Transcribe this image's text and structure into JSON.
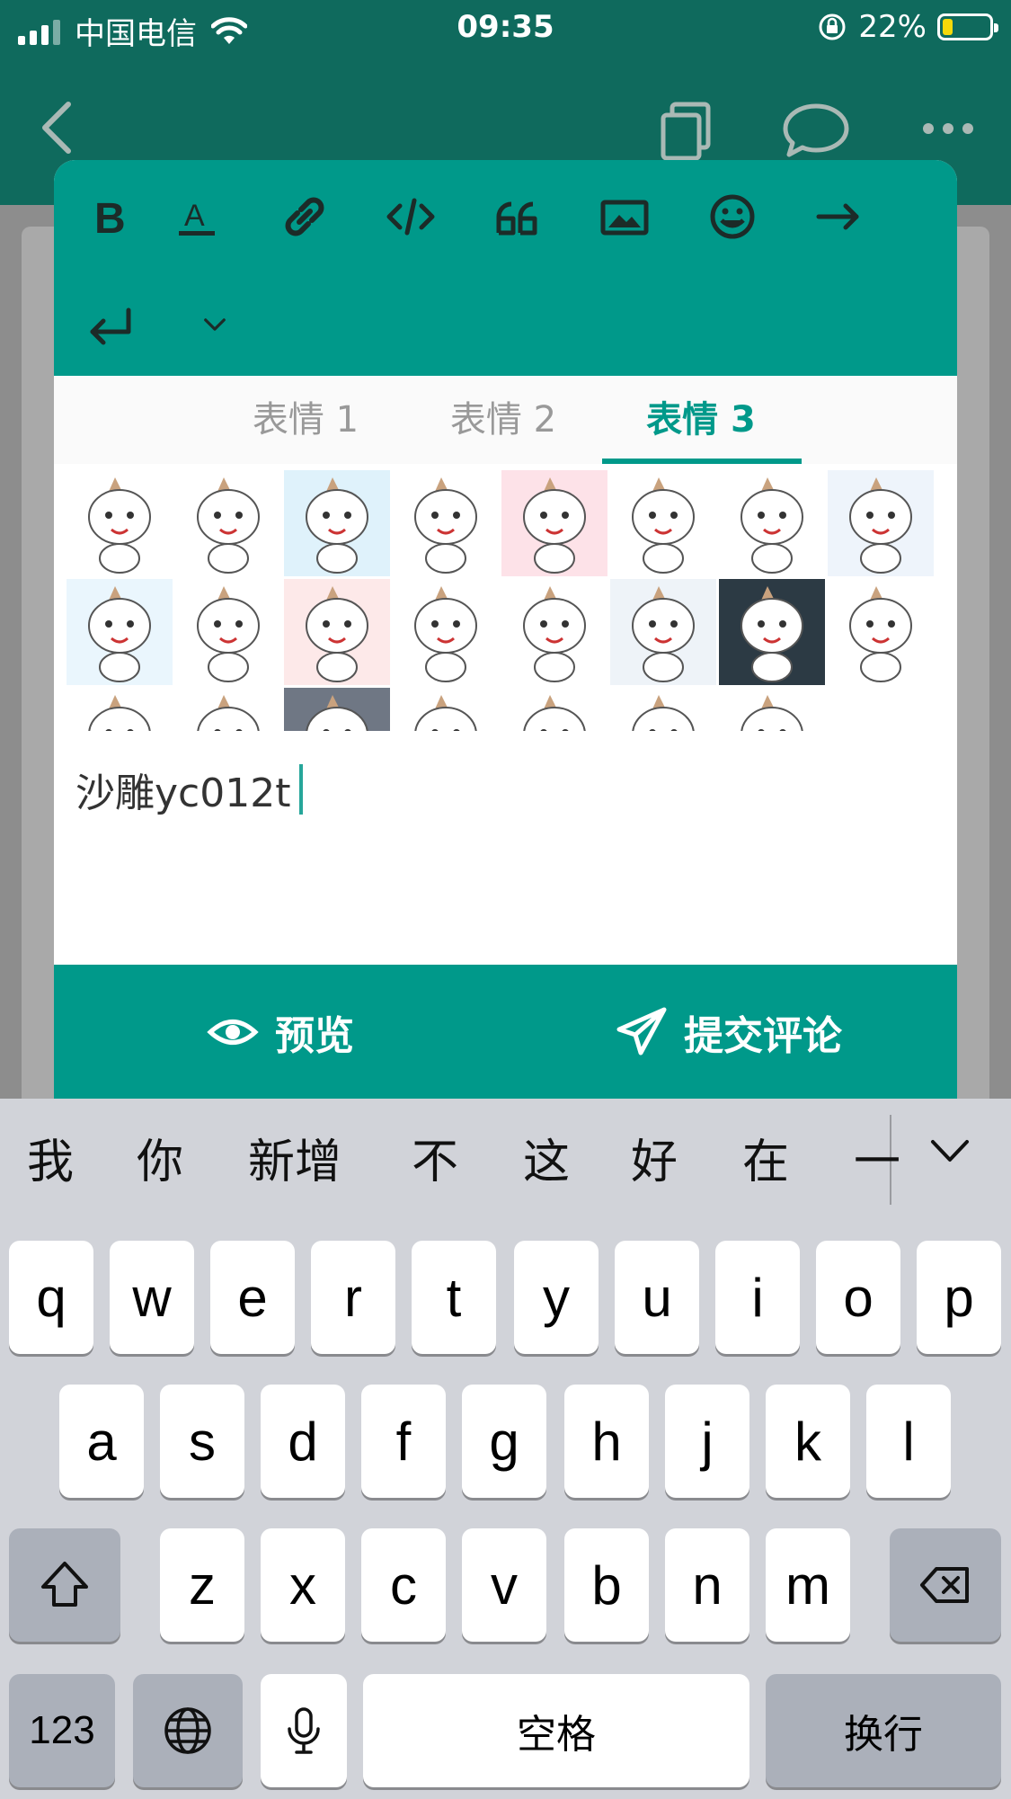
{
  "status_bar": {
    "carrier": "中国电信",
    "time": "09:35",
    "battery_percent": "22%",
    "battery_level": 0.22,
    "icons": [
      "signal-icon",
      "wifi-icon",
      "rotation-lock-icon",
      "battery-icon"
    ]
  },
  "app_bar": {
    "icons": [
      "back-icon",
      "copy-icon",
      "chat-icon",
      "more-icon"
    ]
  },
  "toolbar": {
    "tools": [
      "bold-icon",
      "font-color-icon",
      "link-icon",
      "code-icon",
      "quote-icon",
      "image-icon",
      "emoji-icon",
      "arrow-right-icon",
      "enter-icon",
      "chevron-down-icon"
    ]
  },
  "emoji_tabs": {
    "tabs": [
      {
        "label": "表情 1",
        "active": false
      },
      {
        "label": "表情 2",
        "active": false
      },
      {
        "label": "表情 3",
        "active": true
      }
    ]
  },
  "comment": {
    "value": "沙雕yc012t"
  },
  "actions": {
    "preview_label": "预览",
    "submit_label": "提交评论"
  },
  "keyboard": {
    "candidates": [
      "我",
      "你",
      "新增",
      "不",
      "这",
      "好",
      "在",
      "一"
    ],
    "row1": [
      "q",
      "w",
      "e",
      "r",
      "t",
      "y",
      "u",
      "i",
      "o",
      "p"
    ],
    "row2": [
      "a",
      "s",
      "d",
      "f",
      "g",
      "h",
      "j",
      "k",
      "l"
    ],
    "row3": [
      "z",
      "x",
      "c",
      "v",
      "b",
      "n",
      "m"
    ],
    "numbers_label": "123",
    "space_label": "空格",
    "return_label": "换行"
  },
  "colors": {
    "app_bar": "#0f6a5d",
    "accent": "#00998a",
    "keyboard_bg": "#d1d3d9"
  }
}
